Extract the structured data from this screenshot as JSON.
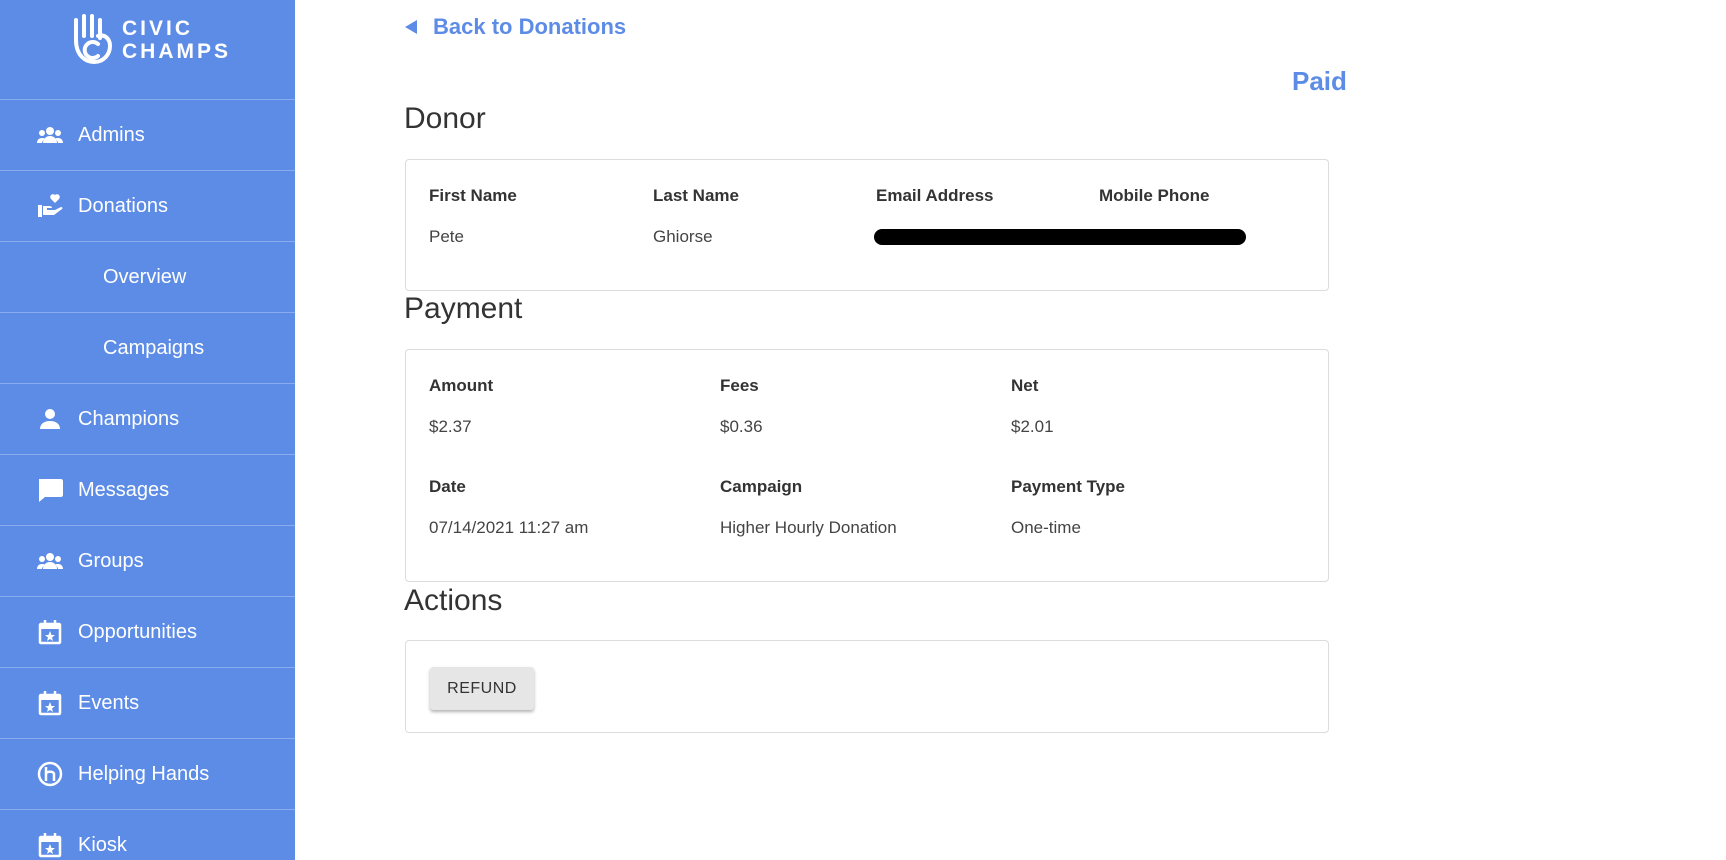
{
  "brand": {
    "line1": "CIVIC",
    "line2": "CHAMPS"
  },
  "sidebar": {
    "items": [
      {
        "label": "Admins",
        "icon": "people-icon"
      },
      {
        "label": "Donations",
        "icon": "hand-heart-icon"
      },
      {
        "label": "Overview"
      },
      {
        "label": "Campaigns"
      },
      {
        "label": "Champions",
        "icon": "person-icon"
      },
      {
        "label": "Messages",
        "icon": "chat-icon"
      },
      {
        "label": "Groups",
        "icon": "people-icon"
      },
      {
        "label": "Opportunities",
        "icon": "calendar-star-icon"
      },
      {
        "label": "Events",
        "icon": "calendar-star-icon"
      },
      {
        "label": "Helping Hands",
        "icon": "helping-hands-icon"
      },
      {
        "label": "Kiosk",
        "icon": "calendar-star-icon"
      }
    ]
  },
  "header": {
    "back_label": "Back to Donations",
    "status": "Paid"
  },
  "donor": {
    "title": "Donor",
    "first_name_label": "First Name",
    "first_name": "Pete",
    "last_name_label": "Last Name",
    "last_name": "Ghiorse",
    "email_label": "Email Address",
    "phone_label": "Mobile Phone"
  },
  "payment": {
    "title": "Payment",
    "amount_label": "Amount",
    "amount": "$2.37",
    "fees_label": "Fees",
    "fees": "$0.36",
    "net_label": "Net",
    "net": "$2.01",
    "date_label": "Date",
    "date": "07/14/2021 11:27 am",
    "campaign_label": "Campaign",
    "campaign": "Higher Hourly Donation",
    "type_label": "Payment Type",
    "type": "One-time"
  },
  "actions": {
    "title": "Actions",
    "refund_label": "REFUND"
  },
  "colors": {
    "sidebar": "#5d8ce6",
    "accent": "#5d8ce6"
  }
}
